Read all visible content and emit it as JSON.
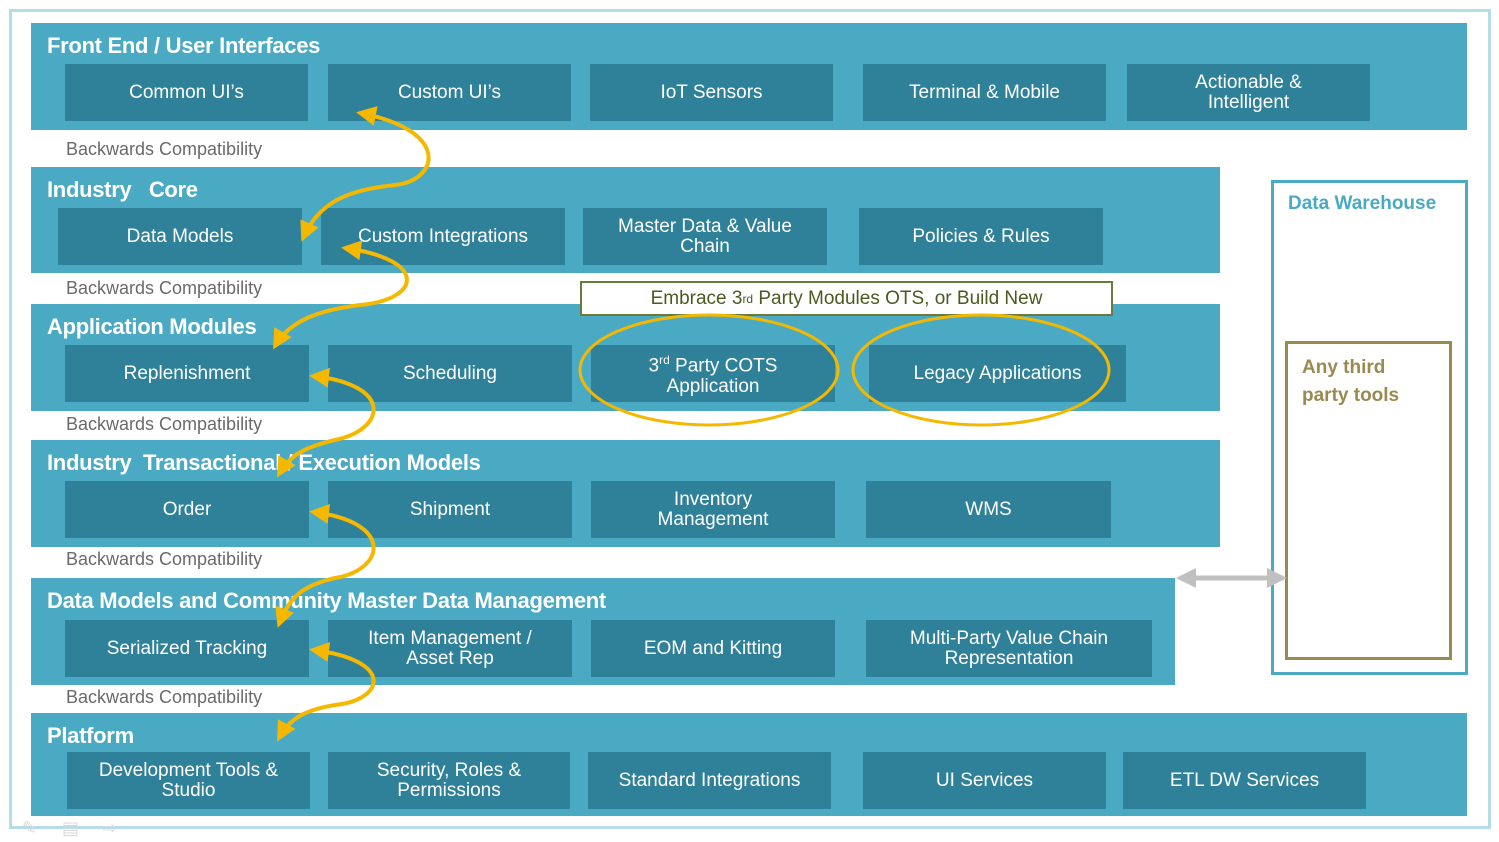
{
  "layers": [
    {
      "title": "Front End / User Interfaces",
      "boxes": [
        "Common UI’s",
        "Custom UI’s",
        "IoT Sensors",
        "Terminal & Mobile",
        "Actionable &\nIntelligent"
      ]
    },
    {
      "title": "Industry   Core",
      "boxes": [
        "Data Models",
        "Custom Integrations",
        "Master Data & Value\nChain",
        "Policies & Rules"
      ]
    },
    {
      "title": "Application Modules",
      "boxes": [
        "Replenishment",
        "Scheduling",
        "3rd Party COTS\nApplication",
        "Legacy Applications"
      ]
    },
    {
      "title": "Industry  Transactional / Execution Models",
      "boxes": [
        "Order",
        "Shipment",
        "Inventory\nManagement",
        "WMS"
      ]
    },
    {
      "title": "Data Models and Community Master Data Management",
      "boxes": [
        "Serialized Tracking",
        "Item Management /\nAsset  Rep",
        "EOM and Kitting",
        "Multi-Party Value Chain\nRepresentation"
      ]
    },
    {
      "title": "Platform",
      "boxes": [
        "Development Tools &\nStudio",
        "Security, Roles  &\nPermissions",
        "Standard Integrations",
        "UI Services",
        "ETL DW Services"
      ]
    }
  ],
  "backwards_compatibility_label": "Backwards Compatibility",
  "callout": {
    "prefix": "Embrace 3",
    "sup": "rd",
    "suffix": " Party Modules OTS, or Build New"
  },
  "cots_box": {
    "prefix": "3",
    "sup": "rd",
    "line1_rest": " Party COTS",
    "line2": "Application"
  },
  "data_warehouse": {
    "title": "Data Warehouse",
    "inner_title": "Any third\nparty tools"
  },
  "colors": {
    "band": "#4aaac4",
    "box": "#2f8199",
    "arrow": "#f5b800",
    "highlight_ellipse": "#f5b800",
    "callout_border": "#6b7a3a",
    "third_party_border": "#9a8a50",
    "connector": "#c0c0c0"
  },
  "footer_icons": [
    "pen-icon",
    "menu-icon",
    "next-arrow-icon"
  ]
}
